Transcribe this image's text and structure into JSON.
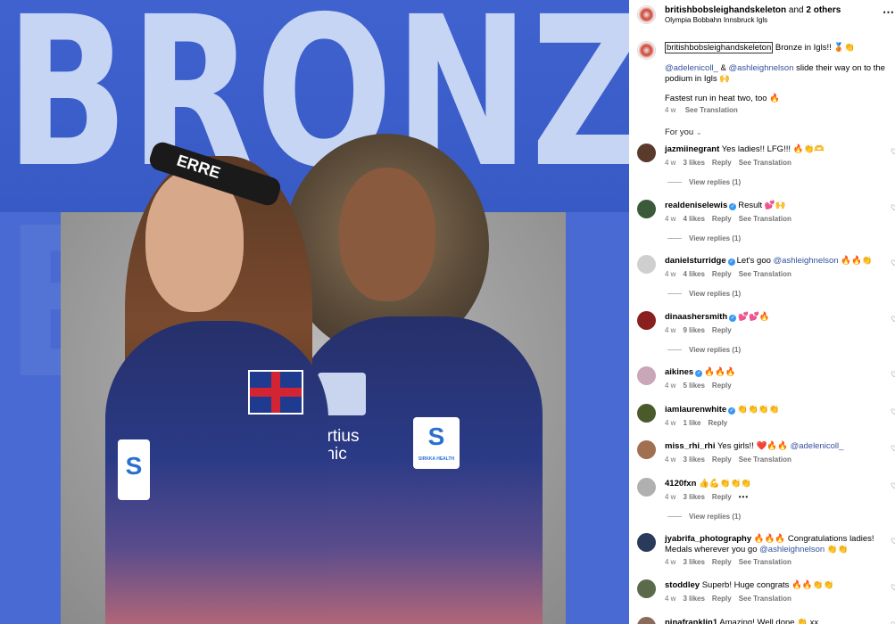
{
  "media": {
    "headline": "BRONZE",
    "ghost_text": "BR",
    "suit_text_left": "ERRE",
    "suit_text_right": "ortius\nlinic",
    "badge_left": "S",
    "badge_right": "S",
    "badge_right_label": "SIRKKA HEALTH",
    "colors": {
      "bg": "#3858c4",
      "word": "#c7d5f4"
    }
  },
  "header": {
    "username": "britishbobsleighandskeleton",
    "and_text": "and",
    "others": "2 others",
    "location": "Olympia Bobbahn Innsbruck Igls",
    "more_icon": "⋯"
  },
  "caption": {
    "username": "britishbobsleighandskeleton",
    "line1_rest": "Bronze in Igls!! 🥉👏",
    "mention1": "@adelenicoll_",
    "amp": "&",
    "mention2": "@ashleighnelson",
    "line2_rest": "slide their way on to the podium in Igls 🙌",
    "line3": "Fastest run in heat two, too 🔥",
    "time": "4 w",
    "see_translation": "See Translation"
  },
  "for_you": "For you",
  "comments": [
    {
      "user": "jazmiinegrant",
      "verified": false,
      "text": "Yes ladies!! LFG!!! 🔥👏🫶",
      "mention": "",
      "text2": "",
      "time": "4 w",
      "likes": "3 likes",
      "reply": "Reply",
      "translate": "See Translation",
      "view_replies": "View replies (1)",
      "more": "",
      "avatar_color": "#5a3a2a"
    },
    {
      "user": "realdeniselewis",
      "verified": true,
      "text": "Result 💕🙌",
      "mention": "",
      "text2": "",
      "time": "4 w",
      "likes": "4 likes",
      "reply": "Reply",
      "translate": "See Translation",
      "view_replies": "View replies (1)",
      "more": "",
      "avatar_color": "#3a5a3a"
    },
    {
      "user": "danielsturridge",
      "verified": true,
      "text": "Let's goo",
      "mention": "@ashleighnelson",
      "text2": "🔥🔥👏",
      "time": "4 w",
      "likes": "4 likes",
      "reply": "Reply",
      "translate": "See Translation",
      "view_replies": "View replies (1)",
      "more": "",
      "avatar_color": "#cfcfcf"
    },
    {
      "user": "dinaashersmith",
      "verified": true,
      "text": "💕💕🔥",
      "mention": "",
      "text2": "",
      "time": "4 w",
      "likes": "9 likes",
      "reply": "Reply",
      "translate": "",
      "view_replies": "View replies (1)",
      "more": "",
      "avatar_color": "#8a1f1f"
    },
    {
      "user": "aikines",
      "verified": true,
      "text": "🔥🔥🔥",
      "mention": "",
      "text2": "",
      "time": "4 w",
      "likes": "5 likes",
      "reply": "Reply",
      "translate": "",
      "view_replies": "",
      "more": "",
      "avatar_color": "#c9a6b8"
    },
    {
      "user": "iamlaurenwhite",
      "verified": true,
      "text": "👏👏👏👏",
      "mention": "",
      "text2": "",
      "time": "4 w",
      "likes": "1 like",
      "reply": "Reply",
      "translate": "",
      "view_replies": "",
      "more": "",
      "avatar_color": "#4b5a2a"
    },
    {
      "user": "miss_rhi_rhi",
      "verified": false,
      "text": "Yes girls!! ❤️🔥🔥",
      "mention": "@adelenicoll_",
      "text2": "",
      "time": "4 w",
      "likes": "3 likes",
      "reply": "Reply",
      "translate": "See Translation",
      "view_replies": "",
      "more": "",
      "avatar_color": "#a07050"
    },
    {
      "user": "4120fxn",
      "verified": false,
      "text": "👍💪👏👏👏",
      "mention": "",
      "text2": "",
      "time": "4 w",
      "likes": "3 likes",
      "reply": "Reply",
      "translate": "",
      "view_replies": "View replies (1)",
      "more": "•••",
      "avatar_color": "#b0b0b0"
    },
    {
      "user": "jyabrifa_photography",
      "verified": false,
      "text": "🔥🔥🔥 Congratulations ladies! Medals wherever you go",
      "mention": "@ashleighnelson",
      "text2": "👏👏",
      "time": "4 w",
      "likes": "3 likes",
      "reply": "Reply",
      "translate": "See Translation",
      "view_replies": "",
      "more": "",
      "avatar_color": "#2a3a5a"
    },
    {
      "user": "stoddley",
      "verified": false,
      "text": "Superb! Huge congrats 🔥🔥👏👏",
      "mention": "",
      "text2": "",
      "time": "4 w",
      "likes": "3 likes",
      "reply": "Reply",
      "translate": "See Translation",
      "view_replies": "",
      "more": "",
      "avatar_color": "#5a6a4a"
    },
    {
      "user": "ninafranklin1",
      "verified": false,
      "text": "Amazing! Well done 👏 xx",
      "mention": "",
      "text2": "",
      "time": "",
      "likes": "",
      "reply": "",
      "translate": "",
      "view_replies": "",
      "more": "",
      "avatar_color": "#8a6a5a"
    }
  ]
}
